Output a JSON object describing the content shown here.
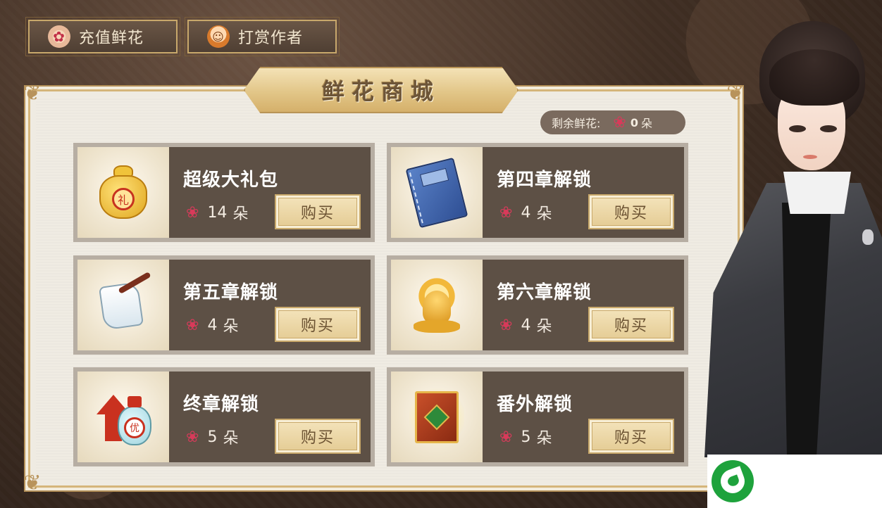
{
  "top_buttons": {
    "recharge_label": "充值鲜花",
    "tip_label": "打赏作者"
  },
  "shop": {
    "title": "鲜花商城",
    "remaining_label": "剩余鲜花:",
    "remaining_count": "0",
    "unit": "朵"
  },
  "items": [
    {
      "name": "超级大礼包",
      "price": "14",
      "unit": "朵",
      "buy_label": "购买",
      "icon": "gift-bag-icon"
    },
    {
      "name": "第四章解锁",
      "price": "4",
      "unit": "朵",
      "buy_label": "购买",
      "icon": "blue-book-icon"
    },
    {
      "name": "第五章解锁",
      "price": "4",
      "unit": "朵",
      "buy_label": "购买",
      "icon": "scroll-brush-icon"
    },
    {
      "name": "第六章解锁",
      "price": "4",
      "unit": "朵",
      "buy_label": "购买",
      "icon": "golden-buddha-icon"
    },
    {
      "name": "终章解锁",
      "price": "5",
      "unit": "朵",
      "buy_label": "购买",
      "icon": "potion-arrow-icon"
    },
    {
      "name": "番外解锁",
      "price": "5",
      "unit": "朵",
      "buy_label": "购买",
      "icon": "red-book-icon"
    }
  ],
  "seals": {
    "gift_bag": "礼",
    "potion": "优"
  },
  "colors": {
    "card_body": "#5d5045",
    "button_gold": "#e4cb93",
    "rose": "#d83a5a"
  }
}
